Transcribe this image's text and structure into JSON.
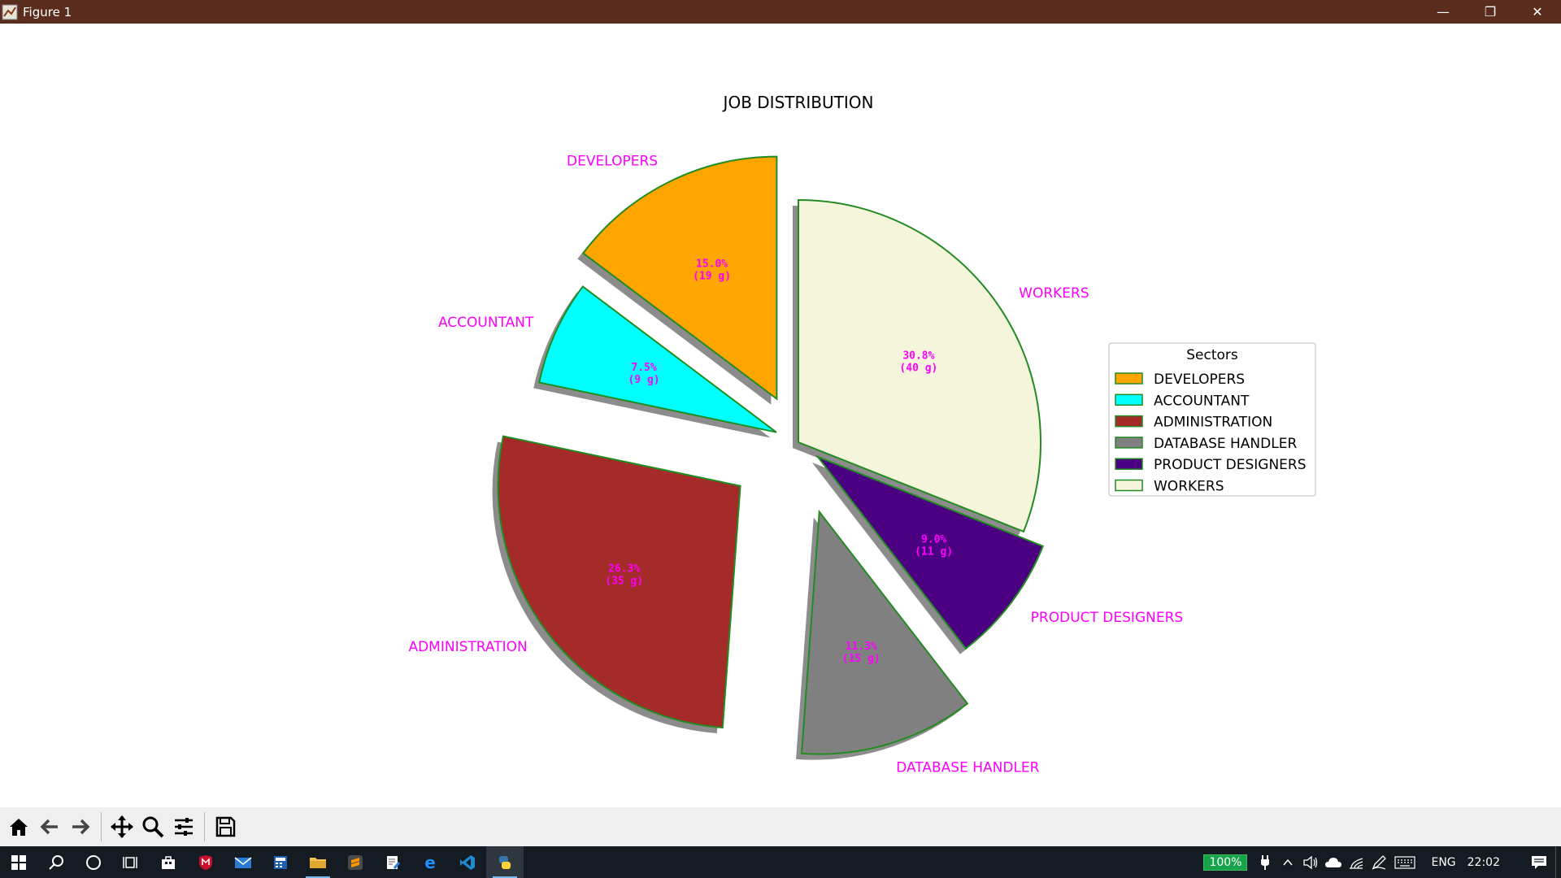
{
  "window": {
    "title": "Figure 1",
    "controls": {
      "minimize": "—",
      "restore": "❐",
      "close": "✕"
    }
  },
  "chart_data": {
    "type": "pie",
    "title": "JOB DISTRIBUTION",
    "labels": [
      "DEVELOPERS",
      "ACCOUNTANT",
      "ADMINISTRATION",
      "DATABASE HANDLER",
      "PRODUCT DESIGNERS",
      "WORKERS"
    ],
    "values": [
      19,
      9,
      35,
      15,
      11,
      40
    ],
    "percent_labels": [
      "15.0%",
      "7.5%",
      "26.3%",
      "11.3%",
      "9.0%",
      "30.8%"
    ],
    "value_labels": [
      "(19 g)",
      "(9 g)",
      "(35 g)",
      "(15 g)",
      "(11 g)",
      "(40 g)"
    ],
    "colors": [
      "#ffa500",
      "#00ffff",
      "#a52a2a",
      "#808080",
      "#4b0082",
      "#f5f5dc"
    ],
    "explode": [
      0.2,
      0.1,
      0.3,
      0.3,
      0.1,
      0.0
    ],
    "start_angle": 90,
    "direction": "counterclockwise",
    "shadow": true,
    "edge_color": "#228b22",
    "label_color": "#ff00ff",
    "legend": {
      "title": "Sectors",
      "placement": "right",
      "entries": [
        "DEVELOPERS",
        "ACCOUNTANT",
        "ADMINISTRATION",
        "DATABASE HANDLER",
        "PRODUCT DESIGNERS",
        "WORKERS"
      ]
    }
  },
  "toolbar": {
    "buttons": [
      "home-icon",
      "back-icon",
      "forward-icon",
      "pan-icon",
      "zoom-icon",
      "configure-icon",
      "save-icon"
    ]
  },
  "taskbar": {
    "apps": [
      "windows-start-icon",
      "search-icon",
      "cortana-icon",
      "task-view-icon",
      "store-icon",
      "mcafee-icon",
      "mail-icon",
      "calculator-icon",
      "file-explorer-icon",
      "sublime-text-icon",
      "notepad-icon",
      "edge-icon",
      "vscode-icon",
      "python-icon"
    ],
    "tray": {
      "battery_percent": "100%",
      "language": "ENG",
      "time": "22:02"
    }
  }
}
